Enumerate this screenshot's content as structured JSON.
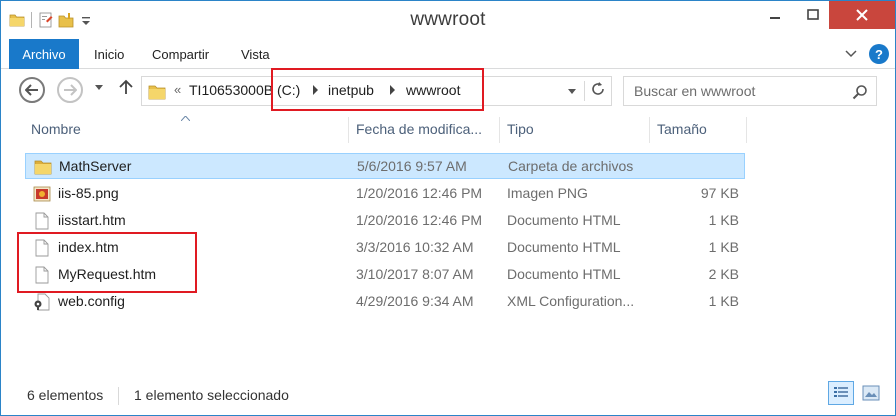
{
  "window": {
    "title": "wwwroot"
  },
  "colors": {
    "accent": "#1979ca",
    "close": "#c9463d",
    "selection": "#cce8ff",
    "annotation": "#e01a22"
  },
  "ribbon": {
    "tabs": [
      {
        "label": "Archivo",
        "active": true
      },
      {
        "label": "Inicio"
      },
      {
        "label": "Compartir"
      },
      {
        "label": "Vista"
      }
    ]
  },
  "address": {
    "overflow": "«",
    "crumbs": [
      "TI10653000B (C:)",
      "inetpub",
      "wwwroot"
    ]
  },
  "search": {
    "placeholder": "Buscar en wwwroot"
  },
  "columns": {
    "name": "Nombre",
    "date": "Fecha de modifica...",
    "type": "Tipo",
    "size": "Tamaño"
  },
  "files": [
    {
      "icon": "folder-icon",
      "name": "MathServer",
      "date": "5/6/2016 9:57 AM",
      "type": "Carpeta de archivos",
      "size": "",
      "selected": true
    },
    {
      "icon": "image-file-icon",
      "name": "iis-85.png",
      "date": "1/20/2016 12:46 PM",
      "type": "Imagen PNG",
      "size": "97 KB"
    },
    {
      "icon": "document-icon",
      "name": "iisstart.htm",
      "date": "1/20/2016 12:46 PM",
      "type": "Documento HTML",
      "size": "1 KB"
    },
    {
      "icon": "document-icon",
      "name": "index.htm",
      "date": "3/3/2016 10:32 AM",
      "type": "Documento HTML",
      "size": "1 KB"
    },
    {
      "icon": "document-icon",
      "name": "MyRequest.htm",
      "date": "3/10/2017 8:07 AM",
      "type": "Documento HTML",
      "size": "2 KB"
    },
    {
      "icon": "config-file-icon",
      "name": "web.config",
      "date": "4/29/2016 9:34 AM",
      "type": "XML Configuration...",
      "size": "1 KB"
    }
  ],
  "status": {
    "count": "6 elementos",
    "selection": "1 elemento seleccionado"
  }
}
